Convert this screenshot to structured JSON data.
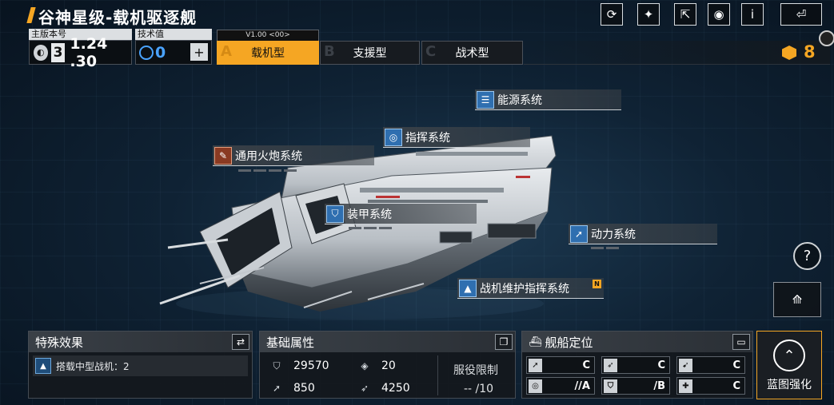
{
  "title": "谷神星级-载机驱逐舰",
  "toolbar": {
    "buttons": [
      {
        "name": "refresh-icon",
        "glyph": "⟳"
      },
      {
        "name": "paint-icon",
        "glyph": "✦"
      },
      {
        "name": "share-icon",
        "glyph": "⇱"
      },
      {
        "name": "view-icon",
        "glyph": "◉"
      },
      {
        "name": "info-icon",
        "glyph": "i"
      }
    ],
    "back_glyph": "⏎"
  },
  "version": {
    "label": "主版本号",
    "badge": "3",
    "value": "1.24 .30"
  },
  "tech": {
    "label": "技术值",
    "value": "0"
  },
  "tabs": {
    "version_tag": "V1.00 <00>",
    "items": [
      {
        "letter": "A",
        "label": "载机型"
      },
      {
        "letter": "B",
        "label": "支援型"
      },
      {
        "letter": "C",
        "label": "战术型"
      }
    ]
  },
  "resource": {
    "value": "8"
  },
  "systems": {
    "energy": "能源系统",
    "command": "指挥系统",
    "cannon": "通用火炮系统",
    "armor": "装甲系统",
    "power": "动力系统",
    "fighter_maint": "战机维护指挥系统",
    "fighter_maint_badge": "N"
  },
  "special": {
    "title": "特殊效果",
    "effect": "搭载中型战机：2"
  },
  "attributes": {
    "title": "基础属性",
    "hp": "29570",
    "armor_stat": "20",
    "speed": "850",
    "range": "4250",
    "service_label": "服役限制",
    "service_value": "--  /10"
  },
  "positioning": {
    "title": "舰船定位",
    "roles": [
      "C",
      "C",
      "C",
      "//A",
      "/B",
      "C"
    ]
  },
  "enhance": {
    "label": "蓝图强化"
  },
  "colors": {
    "accent": "#f5a623",
    "tech_blue": "#4aa3ff"
  }
}
